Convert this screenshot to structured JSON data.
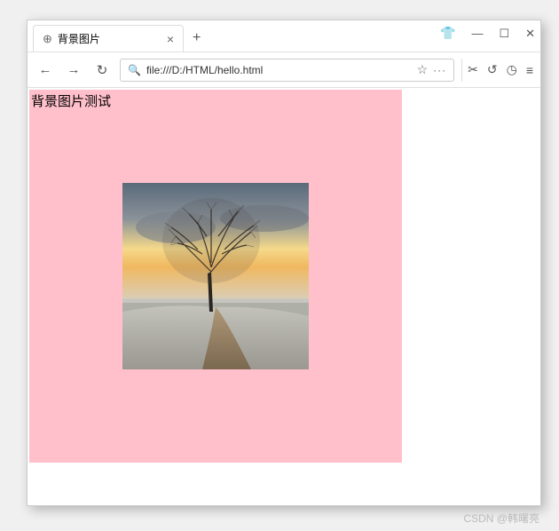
{
  "window": {
    "tab_title": "背景图片",
    "url": "file:///D:/HTML/hello.html"
  },
  "page": {
    "heading": "背景图片测试",
    "box_color": "#FFC0CB"
  },
  "icons": {
    "globe": "⊕",
    "close": "×",
    "plus": "+",
    "shirt": "👕",
    "minimize": "—",
    "maximize": "☐",
    "win_close": "✕",
    "back": "←",
    "forward": "→",
    "reload": "↻",
    "search": "🔍",
    "star": "☆",
    "dots": "···",
    "scissors": "✂",
    "undo": "↺",
    "clock": "◷",
    "menu": "≡"
  },
  "watermark": "CSDN @韩曙亮"
}
